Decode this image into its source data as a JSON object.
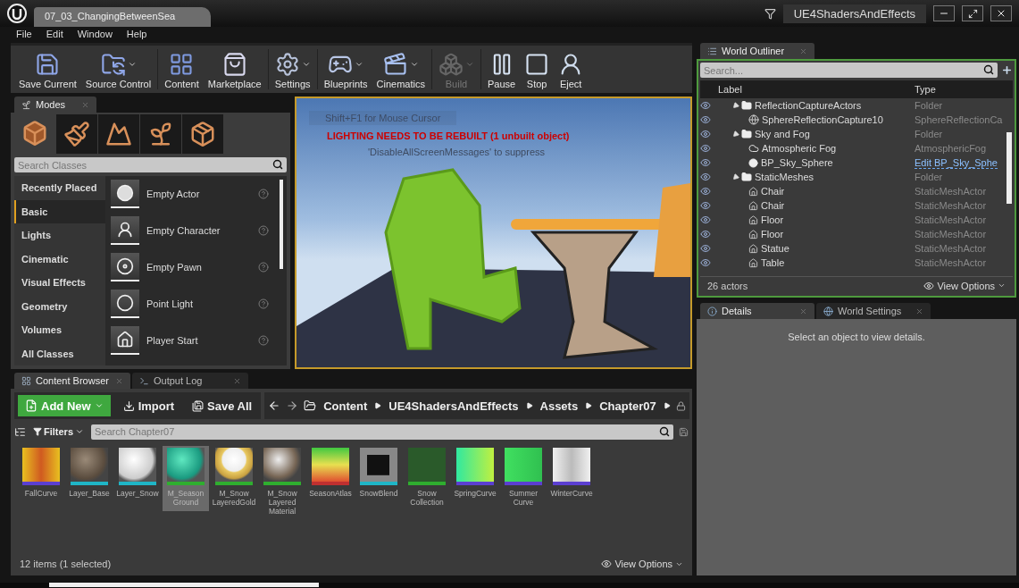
{
  "window": {
    "tab": "07_03_ChangingBetweenSea",
    "project": "UE4ShadersAndEffects"
  },
  "menu": [
    "File",
    "Edit",
    "Window",
    "Help"
  ],
  "toolbar": [
    {
      "label": "Save Current",
      "menu": false,
      "disabled": false
    },
    {
      "label": "Source Control",
      "menu": true,
      "disabled": false
    },
    {
      "label": "Content",
      "menu": false,
      "disabled": false
    },
    {
      "label": "Marketplace",
      "menu": false,
      "disabled": false
    },
    {
      "label": "Settings",
      "menu": true,
      "disabled": false
    },
    {
      "label": "Blueprints",
      "menu": true,
      "disabled": false
    },
    {
      "label": "Cinematics",
      "menu": true,
      "disabled": false
    },
    {
      "label": "Build",
      "menu": true,
      "disabled": true
    },
    {
      "label": "Pause",
      "menu": false,
      "disabled": false
    },
    {
      "label": "Stop",
      "menu": false,
      "disabled": false
    },
    {
      "label": "Eject",
      "menu": false,
      "disabled": false
    }
  ],
  "modes": {
    "title": "Modes",
    "tabs": [
      {
        "selected": true
      },
      {
        "selected": false
      },
      {
        "selected": false
      },
      {
        "selected": false
      },
      {
        "selected": false
      }
    ],
    "search": {
      "placeholder": "Search Classes"
    },
    "categories": [
      {
        "label": "Recently Placed",
        "selected": false
      },
      {
        "label": "Basic",
        "selected": true
      },
      {
        "label": "Lights",
        "selected": false
      },
      {
        "label": "Cinematic",
        "selected": false
      },
      {
        "label": "Visual Effects",
        "selected": false
      },
      {
        "label": "Geometry",
        "selected": false
      },
      {
        "label": "Volumes",
        "selected": false
      },
      {
        "label": "All Classes",
        "selected": false
      }
    ],
    "items": [
      {
        "label": "Empty Actor"
      },
      {
        "label": "Empty Character"
      },
      {
        "label": "Empty Pawn"
      },
      {
        "label": "Point Light"
      },
      {
        "label": "Player Start"
      }
    ]
  },
  "viewport": {
    "hint": "Shift+F1 for Mouse Cursor",
    "warning": "LIGHTING NEEDS TO BE REBUILT (1 unbuilt object)",
    "suppress": "'DisableAllScreenMessages' to suppress"
  },
  "content_browser": {
    "tabs": [
      {
        "label": "Content Browser",
        "selected": true
      },
      {
        "label": "Output Log",
        "selected": false
      }
    ],
    "add_new": "Add New",
    "import": "Import",
    "save_all": "Save All",
    "path": [
      "Content",
      "UE4ShadersAndEffects",
      "Assets",
      "Chapter07"
    ],
    "filters": "Filters",
    "search": {
      "placeholder": "Search Chapter07"
    },
    "assets": [
      {
        "name": "FallCurve",
        "selected": false,
        "color": "#5b3fd1"
      },
      {
        "name": "Layer_Base",
        "selected": false,
        "color": "#1fb5c6"
      },
      {
        "name": "Layer_Snow",
        "selected": false,
        "color": "#1fb5c6"
      },
      {
        "name": "M_Season Ground",
        "selected": true,
        "color": "#2fae2f"
      },
      {
        "name": "M_Snow LayeredGold",
        "selected": false,
        "color": "#2fae2f"
      },
      {
        "name": "M_Snow Layered Material",
        "selected": false,
        "color": "#2fae2f"
      },
      {
        "name": "SeasonAtlas",
        "selected": false,
        "color": "#c03030"
      },
      {
        "name": "SnowBlend",
        "selected": false,
        "color": "#1fb5c6"
      },
      {
        "name": "Snow Collection",
        "selected": false,
        "color": "#2fae2f"
      },
      {
        "name": "SpringCurve",
        "selected": false,
        "color": "#5b3fd1"
      },
      {
        "name": "Summer Curve",
        "selected": false,
        "color": "#5b3fd1"
      },
      {
        "name": "WinterCurve",
        "selected": false,
        "color": "#5b3fd1"
      }
    ],
    "status": "12 items (1 selected)",
    "view_options": "View Options"
  },
  "world_outliner": {
    "title": "World Outliner",
    "search": {
      "placeholder": "Search..."
    },
    "columns": [
      "Label",
      "Type"
    ],
    "tree": [
      {
        "label": "ReflectionCaptureActors",
        "type": "Folder",
        "kind": "folder",
        "link": false,
        "expanded": true,
        "children": [
          {
            "label": "SphereReflectionCapture10",
            "type": "SphereReflectionCa",
            "kind": "capture",
            "link": false
          }
        ]
      },
      {
        "label": "Sky and Fog",
        "type": "Folder",
        "kind": "folder",
        "link": false,
        "expanded": true,
        "children": [
          {
            "label": "Atmospheric Fog",
            "type": "AtmosphericFog",
            "kind": "fog",
            "link": false
          },
          {
            "label": "BP_Sky_Sphere",
            "type": "Edit BP_Sky_Sphe",
            "kind": "sphere",
            "link": true
          }
        ]
      },
      {
        "label": "StaticMeshes",
        "type": "Folder",
        "kind": "folder",
        "link": false,
        "expanded": true,
        "children": [
          {
            "label": "Chair",
            "type": "StaticMeshActor",
            "kind": "mesh",
            "link": false
          },
          {
            "label": "Chair",
            "type": "StaticMeshActor",
            "kind": "mesh",
            "link": false
          },
          {
            "label": "Floor",
            "type": "StaticMeshActor",
            "kind": "mesh",
            "link": false
          },
          {
            "label": "Floor",
            "type": "StaticMeshActor",
            "kind": "mesh",
            "link": false
          },
          {
            "label": "Statue",
            "type": "StaticMeshActor",
            "kind": "mesh",
            "link": false
          },
          {
            "label": "Table",
            "type": "StaticMeshActor",
            "kind": "mesh",
            "link": false
          }
        ]
      }
    ],
    "count": "26 actors",
    "view_options": "View Options"
  },
  "details": {
    "tabs": [
      {
        "label": "Details",
        "selected": true
      },
      {
        "label": "World Settings",
        "selected": false
      }
    ],
    "empty_message": "Select an object to view details."
  }
}
